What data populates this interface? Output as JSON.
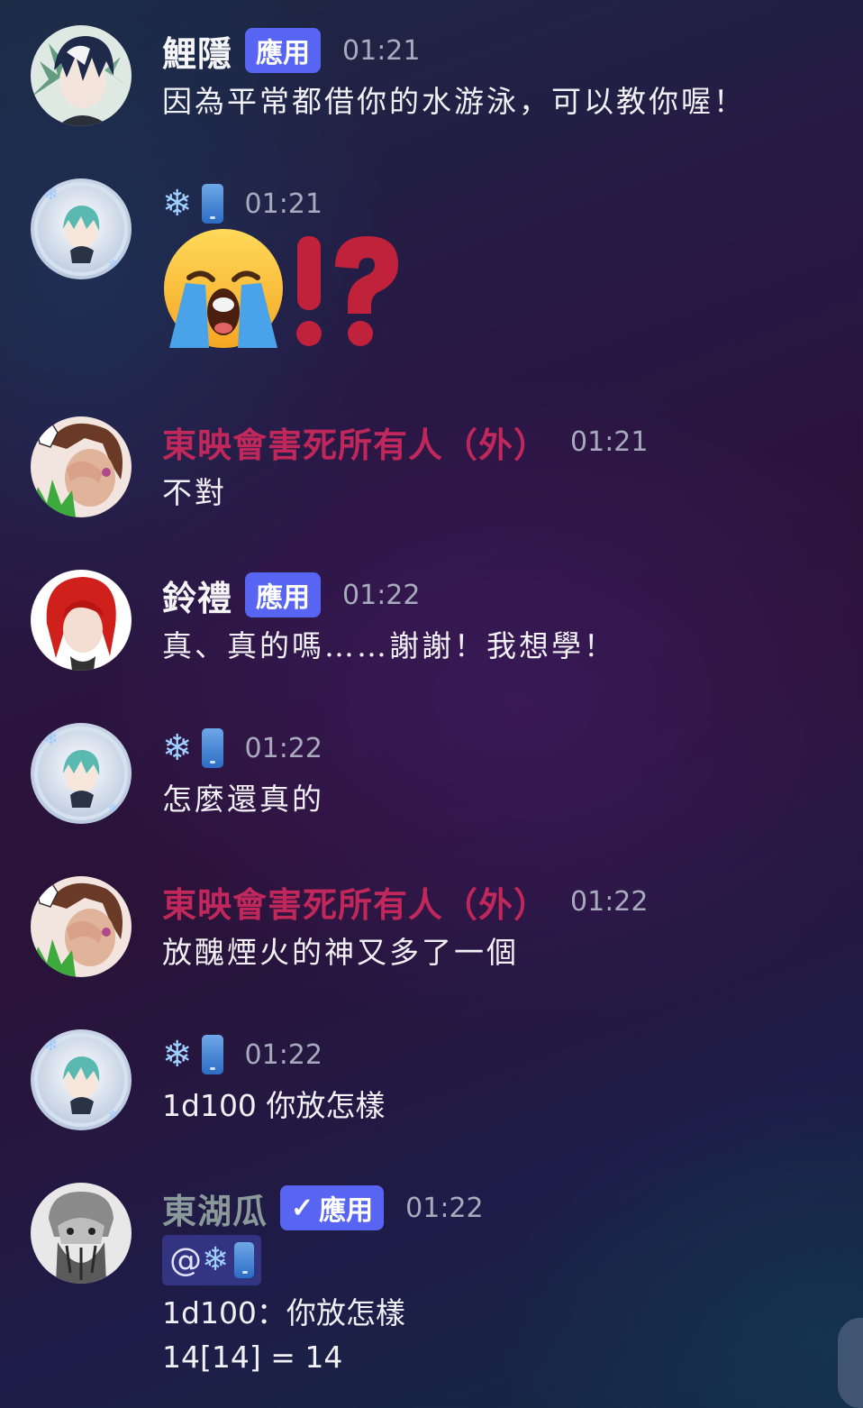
{
  "colors": {
    "accent": "#5865f2",
    "red_name": "#c0275a",
    "timestamp": "#a8abbd"
  },
  "labels": {
    "app_badge": "應用",
    "snow_glyph": "❄"
  },
  "messages": [
    {
      "avatar": "avatar-dark-hair-boy",
      "name": "鯉隱",
      "badge": "應用",
      "time": "01:21",
      "text": "因為平常都借你的水游泳，可以教你喔！"
    },
    {
      "avatar": "avatar-snow-moon",
      "name_icons": [
        "snowflake-icon",
        "phone-icon"
      ],
      "time": "01:21",
      "emoji": [
        "loudly-crying-face",
        "exclamation-question-mark"
      ]
    },
    {
      "avatar": "avatar-brown-hair-grass",
      "name": "東映會害死所有人（外）",
      "time": "01:21",
      "text": "不對"
    },
    {
      "avatar": "avatar-red-hair",
      "name": "鈴禮",
      "badge": "應用",
      "time": "01:22",
      "text": "真、真的嗎……謝謝！我想學！"
    },
    {
      "avatar": "avatar-snow-moon",
      "name_icons": [
        "snowflake-icon",
        "phone-icon"
      ],
      "time": "01:22",
      "text": "怎麼還真的"
    },
    {
      "avatar": "avatar-brown-hair-grass",
      "name": "東映會害死所有人（外）",
      "time": "01:22",
      "text": "放醜煙火的神又多了一個"
    },
    {
      "avatar": "avatar-snow-moon",
      "name_icons": [
        "snowflake-icon",
        "phone-icon"
      ],
      "time": "01:22",
      "text": "1d100 你放怎樣"
    },
    {
      "avatar": "avatar-monster-gray",
      "name": "東湖瓜",
      "badge": "應用",
      "badge_verified": true,
      "time": "01:22",
      "mention": "@",
      "lines": [
        "1d100：你放怎樣",
        "14[14] = 14"
      ]
    }
  ]
}
